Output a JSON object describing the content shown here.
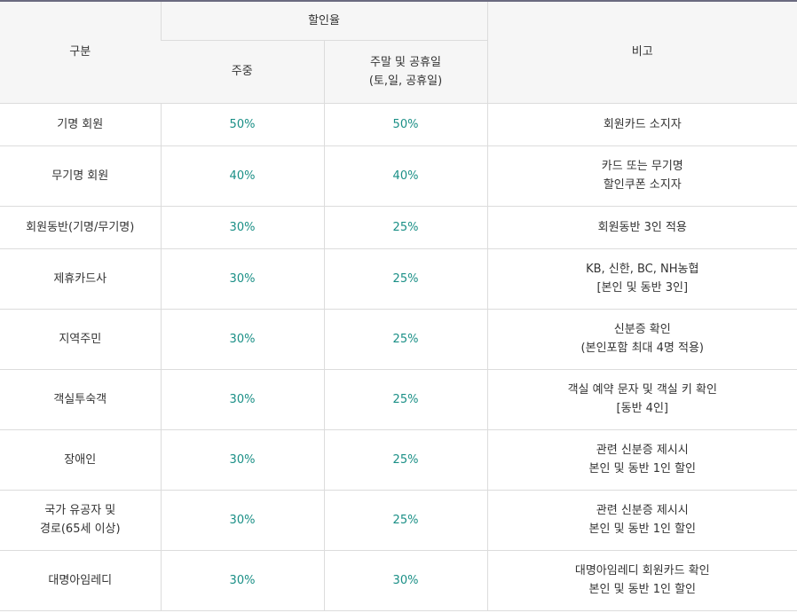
{
  "header": {
    "category": "구분",
    "discount_rate": "할인율",
    "weekday": "주중",
    "weekend_line1": "주말 및 공휴일",
    "weekend_line2": "(토,일, 공휴일)",
    "note": "비고"
  },
  "rows": [
    {
      "category_line1": "기명 회원",
      "category_line2": "",
      "weekday": "50%",
      "weekend": "50%",
      "note_line1": "회원카드 소지자",
      "note_line2": ""
    },
    {
      "category_line1": "무기명 회원",
      "category_line2": "",
      "weekday": "40%",
      "weekend": "40%",
      "note_line1": "카드 또는 무기명",
      "note_line2": "할인쿠폰 소지자"
    },
    {
      "category_line1": "회원동반(기명/무기명)",
      "category_line2": "",
      "weekday": "30%",
      "weekend": "25%",
      "note_line1": "회원동반 3인 적용",
      "note_line2": ""
    },
    {
      "category_line1": "제휴카드사",
      "category_line2": "",
      "weekday": "30%",
      "weekend": "25%",
      "note_line1": "KB, 신한, BC, NH농협",
      "note_line2": "[본인 및 동반 3인]"
    },
    {
      "category_line1": "지역주민",
      "category_line2": "",
      "weekday": "30%",
      "weekend": "25%",
      "note_line1": "신분증 확인",
      "note_line2": "(본인포함 최대 4명 적용)"
    },
    {
      "category_line1": "객실투숙객",
      "category_line2": "",
      "weekday": "30%",
      "weekend": "25%",
      "note_line1": "객실 예약 문자 및 객실 키 확인",
      "note_line2": "[동반 4인]"
    },
    {
      "category_line1": "장애인",
      "category_line2": "",
      "weekday": "30%",
      "weekend": "25%",
      "note_line1": "관련 신분증 제시시",
      "note_line2": "본인 및 동반 1인 할인"
    },
    {
      "category_line1": "국가 유공자 및",
      "category_line2": "경로(65세 이상)",
      "weekday": "30%",
      "weekend": "25%",
      "note_line1": "관련 신분증 제시시",
      "note_line2": "본인 및 동반 1인 할인"
    },
    {
      "category_line1": "대명아임레디",
      "category_line2": "",
      "weekday": "30%",
      "weekend": "30%",
      "note_line1": "대명아임레디 회원카드 확인",
      "note_line2": "본인 및 동반 1인 할인"
    }
  ],
  "colors": {
    "rate_text": "#1a8f86",
    "header_bg": "#f6f6f6",
    "top_border": "#6b6b80"
  }
}
